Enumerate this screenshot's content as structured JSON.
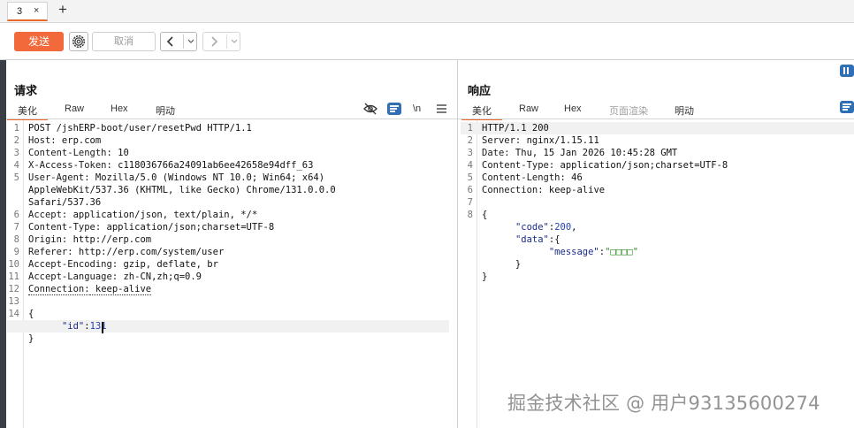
{
  "tabs": {
    "active_tab": "3",
    "close": "×",
    "add": "+"
  },
  "toolbar": {
    "send": "发送",
    "cancel": "取消",
    "back_icon": "chevron-left-icon",
    "forward_icon": "chevron-right-icon"
  },
  "request": {
    "title": "请求",
    "tabs": [
      "美化",
      "Raw",
      "Hex",
      "明动"
    ],
    "active_tab": "美化",
    "icons": [
      "eye-off-icon",
      "wrap-icon",
      "newline-toggle",
      "menu-icon"
    ],
    "newline_label": "\\n",
    "lines": [
      {
        "n": "1",
        "key": "",
        "text": "POST /jshERP-boot/user/resetPwd HTTP/1.1"
      },
      {
        "n": "2",
        "key": "Host:",
        "text": " erp.com"
      },
      {
        "n": "3",
        "key": "Content-Length:",
        "text": " 10"
      },
      {
        "n": "4",
        "key": "X-Access-Token:",
        "text": " c118036766a24091ab6ee42658e94dff_63"
      },
      {
        "n": "5",
        "key": "User-Agent:",
        "text": " Mozilla/5.0 (Windows NT 10.0; Win64; x64)"
      },
      {
        "n": "",
        "key": "",
        "text": "AppleWebKit/537.36 (KHTML, like Gecko) Chrome/131.0.0.0"
      },
      {
        "n": "",
        "key": "",
        "text": "Safari/537.36"
      },
      {
        "n": "6",
        "key": "Accept:",
        "text": " application/json, text/plain, */*"
      },
      {
        "n": "7",
        "key": "Content-Type:",
        "text": " application/json;charset=UTF-8"
      },
      {
        "n": "8",
        "key": "Origin:",
        "text": " http://erp.com"
      },
      {
        "n": "9",
        "key": "Referer:",
        "text": " http://erp.com/system/user"
      },
      {
        "n": "10",
        "key": "Accept-Encoding:",
        "text": " gzip, deflate, br"
      },
      {
        "n": "11",
        "key": "Accept-Language:",
        "text": " zh-CN,zh;q=0.9"
      },
      {
        "n": "12",
        "key": "Connection:",
        "text": " keep-alive"
      },
      {
        "n": "13",
        "key": "",
        "text": ""
      },
      {
        "n": "14",
        "key": "",
        "text": "{"
      },
      {
        "n": "",
        "key": "",
        "text": "      \"id\":131"
      },
      {
        "n": "",
        "key": "",
        "text": "}"
      }
    ]
  },
  "response": {
    "title": "响应",
    "tabs": [
      "美化",
      "Raw",
      "Hex",
      "页面渲染",
      "明动"
    ],
    "active_tab": "美化",
    "icons": [
      "wrap-icon",
      "panel-layout-icon"
    ],
    "lines": [
      {
        "n": "1",
        "key": "",
        "text": "HTTP/1.1 200"
      },
      {
        "n": "2",
        "key": "Server:",
        "text": " nginx/1.15.11"
      },
      {
        "n": "3",
        "key": "Date:",
        "text": " Thu, 15 Jan 2026 10:45:28 GMT"
      },
      {
        "n": "4",
        "key": "Content-Type:",
        "text": " application/json;charset=UTF-8"
      },
      {
        "n": "5",
        "key": "Content-Length:",
        "text": " 46"
      },
      {
        "n": "6",
        "key": "Connection:",
        "text": " keep-alive"
      },
      {
        "n": "7",
        "key": "",
        "text": ""
      },
      {
        "n": "8",
        "key": "",
        "text": "{"
      },
      {
        "n": "",
        "key": "",
        "text": "      \"code\":200,"
      },
      {
        "n": "",
        "key": "",
        "text": "      \"data\":{"
      },
      {
        "n": "",
        "key": "",
        "text": "            \"message\":\"□□□□\""
      },
      {
        "n": "",
        "key": "",
        "text": "      }"
      },
      {
        "n": "",
        "key": "",
        "text": "}"
      }
    ]
  },
  "watermark": "掘金技术社区 @ 用户93135600274",
  "colors": {
    "accent": "#e8682e",
    "send_button": "#f26a3c",
    "icon_blue": "#2f6fb5"
  }
}
